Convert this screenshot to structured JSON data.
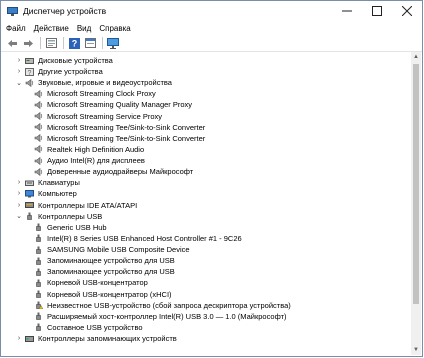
{
  "window": {
    "title": "Диспетчер устройств",
    "minimize_icon": "minimize-icon",
    "maximize_icon": "maximize-icon",
    "close_icon": "close-icon"
  },
  "menu": [
    "Файл",
    "Действие",
    "Вид",
    "Справка"
  ],
  "toolbar": [
    "back-arrow-icon",
    "forward-arrow-icon",
    "properties-icon",
    "help-icon",
    "properties-panel-icon",
    "monitor-icon"
  ],
  "tree": [
    {
      "label": "Дисковые устройства",
      "level": 1,
      "expander": "collapsed",
      "icon": "disk-icon"
    },
    {
      "label": "Другие устройства",
      "level": 1,
      "expander": "collapsed",
      "icon": "unknown-device-icon"
    },
    {
      "label": "Звуковые, игровые и видеоустройства",
      "level": 1,
      "expander": "expanded",
      "icon": "speaker-icon"
    },
    {
      "label": "Microsoft Streaming Clock Proxy",
      "level": 2,
      "icon": "speaker-icon"
    },
    {
      "label": "Microsoft Streaming Quality Manager Proxy",
      "level": 2,
      "icon": "speaker-icon"
    },
    {
      "label": "Microsoft Streaming Service Proxy",
      "level": 2,
      "icon": "speaker-icon"
    },
    {
      "label": "Microsoft Streaming Tee/Sink-to-Sink Converter",
      "level": 2,
      "icon": "speaker-icon"
    },
    {
      "label": "Microsoft Streaming Tee/Sink-to-Sink Converter",
      "level": 2,
      "icon": "speaker-icon"
    },
    {
      "label": "Realtek High Definition Audio",
      "level": 2,
      "icon": "speaker-icon"
    },
    {
      "label": "Аудио Intel(R) для дисплеев",
      "level": 2,
      "icon": "speaker-icon"
    },
    {
      "label": "Доверенные аудиодрайверы Майкрософт",
      "level": 2,
      "icon": "speaker-icon"
    },
    {
      "label": "Клавиатуры",
      "level": 1,
      "expander": "collapsed",
      "icon": "keyboard-icon"
    },
    {
      "label": "Компьютер",
      "level": 1,
      "expander": "collapsed",
      "icon": "computer-icon"
    },
    {
      "label": "Контроллеры IDE ATA/ATAPI",
      "level": 1,
      "expander": "collapsed",
      "icon": "ide-controller-icon"
    },
    {
      "label": "Контроллеры USB",
      "level": 1,
      "expander": "expanded",
      "icon": "usb-icon"
    },
    {
      "label": "Generic USB Hub",
      "level": 2,
      "icon": "usb-icon"
    },
    {
      "label": "Intel(R) 8 Series USB Enhanced Host Controller #1 - 9C26",
      "level": 2,
      "icon": "usb-icon"
    },
    {
      "label": "SAMSUNG Mobile USB Composite Device",
      "level": 2,
      "icon": "usb-icon"
    },
    {
      "label": "Запоминающее устройство для USB",
      "level": 2,
      "icon": "usb-icon"
    },
    {
      "label": "Запоминающее устройство для USB",
      "level": 2,
      "icon": "usb-icon"
    },
    {
      "label": "Корневой USB-концентратор",
      "level": 2,
      "icon": "usb-icon"
    },
    {
      "label": "Корневой USB-концентратор (xHCI)",
      "level": 2,
      "icon": "usb-icon"
    },
    {
      "label": "Неизвестное USB-устройство (сбой запроса дескриптора устройства)",
      "level": 2,
      "icon": "warning-usb-icon"
    },
    {
      "label": "Расширяемый хост-контроллер Intel(R) USB 3.0 — 1.0 (Майкрософт)",
      "level": 2,
      "icon": "usb-icon"
    },
    {
      "label": "Составное USB устройство",
      "level": 2,
      "icon": "usb-icon"
    },
    {
      "label": "Контроллеры запоминающих устройств",
      "level": 1,
      "expander": "collapsed",
      "icon": "storage-controller-icon"
    }
  ]
}
